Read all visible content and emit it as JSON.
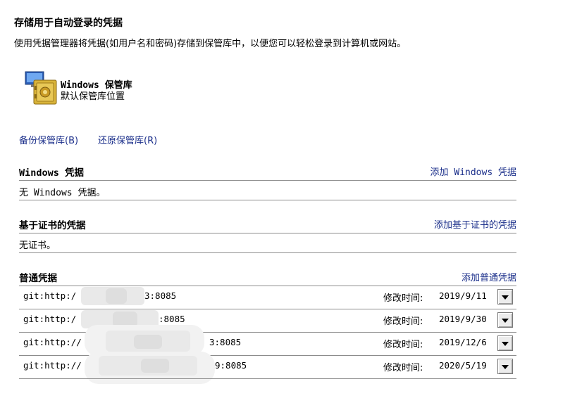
{
  "header": {
    "title": "存储用于自动登录的凭据",
    "description": "使用凭据管理器将凭据(如用户名和密码)存储到保管库中，以便您可以轻松登录到计算机或网站。"
  },
  "vault": {
    "icon": "vault-safe-icon",
    "title": "Windows 保管库",
    "subtitle": "默认保管库位置"
  },
  "actions": {
    "backup": "备份保管库(B)",
    "restore": "还原保管库(R)"
  },
  "windows_credentials": {
    "title": "Windows 凭据",
    "add_link": "添加 Windows 凭据",
    "empty": "无 Windows 凭据。"
  },
  "certificate_credentials": {
    "title": "基于证书的凭据",
    "add_link": "添加基于证书的凭据",
    "empty": "无证书。"
  },
  "generic_credentials": {
    "title": "普通凭据",
    "add_link": "添加普通凭据",
    "modified_label": "修改时间:",
    "items": [
      {
        "prefix": "git:http:/",
        "suffix": "3:8085",
        "date": "2019/9/11"
      },
      {
        "prefix": "git:http:/",
        "suffix": ":8085",
        "date": "2019/9/30"
      },
      {
        "prefix": "git:http://",
        "suffix": "3:8085",
        "date": "2019/12/6"
      },
      {
        "prefix": "git:http://",
        "suffix": "9:8085",
        "date": "2020/5/19"
      }
    ]
  }
}
